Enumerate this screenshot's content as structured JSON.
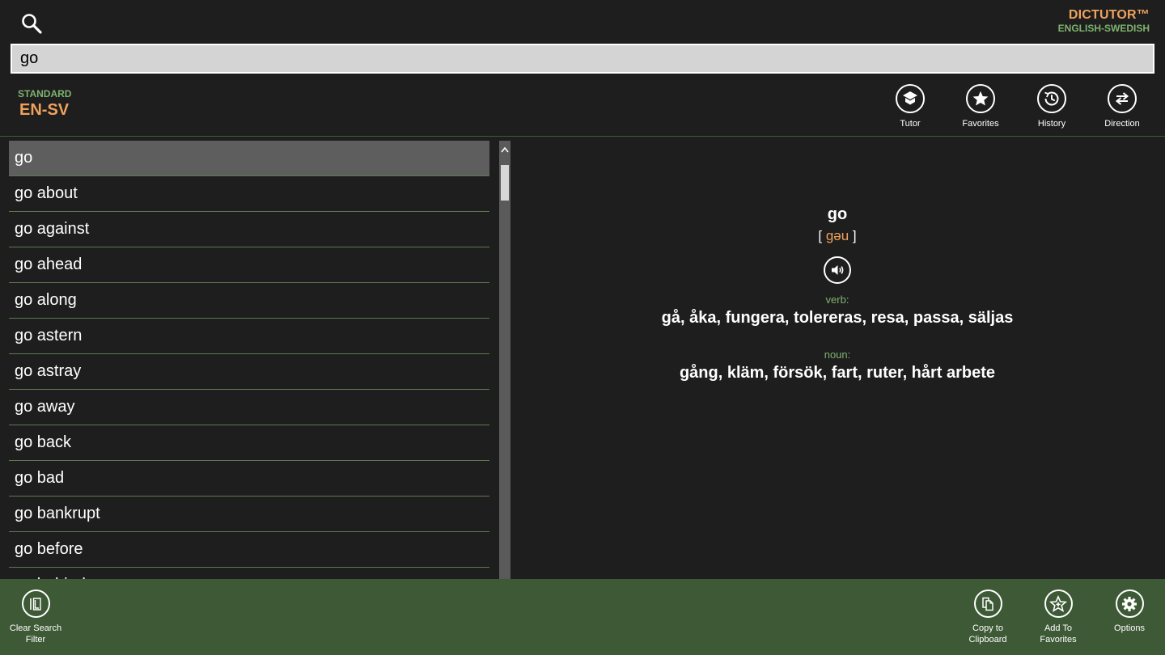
{
  "header": {
    "search_query": "go",
    "brand_name": "DICTUTOR™",
    "brand_subtitle": "ENGLISH-SWEDISH",
    "mode_label": "STANDARD",
    "language_pair": "EN-SV",
    "actions": [
      {
        "icon": "graduation-cap-icon",
        "label": "Tutor"
      },
      {
        "icon": "star-icon",
        "label": "Favorites"
      },
      {
        "icon": "clock-icon",
        "label": "History"
      },
      {
        "icon": "swap-arrows-icon",
        "label": "Direction"
      }
    ]
  },
  "word_list": {
    "selected_index": 0,
    "items": [
      "go",
      "go about",
      "go against",
      "go ahead",
      "go along",
      "go astern",
      "go astray",
      "go away",
      "go back",
      "go bad",
      "go bankrupt",
      "go before",
      "go behind"
    ]
  },
  "definition": {
    "headword": "go",
    "pron_open": "[",
    "pronunciation": "gəu",
    "pron_close": "]",
    "senses": [
      {
        "pos": "verb:",
        "translations": "gå, åka, fungera, tolereras, resa, passa, säljas"
      },
      {
        "pos": "noun:",
        "translations": "gång, kläm, försök, fart, ruter, hårt arbete"
      }
    ]
  },
  "appbar": {
    "left": [
      {
        "icon": "clear-filter-icon",
        "label_line1": "Clear Search",
        "label_line2": "Filter"
      }
    ],
    "right": [
      {
        "icon": "copy-icon",
        "label_line1": "Copy to",
        "label_line2": "Clipboard"
      },
      {
        "icon": "star-add-icon",
        "label_line1": "Add To Favorites",
        "label_line2": ""
      },
      {
        "icon": "gear-icon",
        "label_line1": "Options",
        "label_line2": ""
      }
    ]
  },
  "colors": {
    "background": "#1e1e1e",
    "accent_orange": "#f0a25c",
    "accent_green": "#7fb36e",
    "appbar": "#3d5935",
    "selected_row": "#5e5e5e"
  }
}
